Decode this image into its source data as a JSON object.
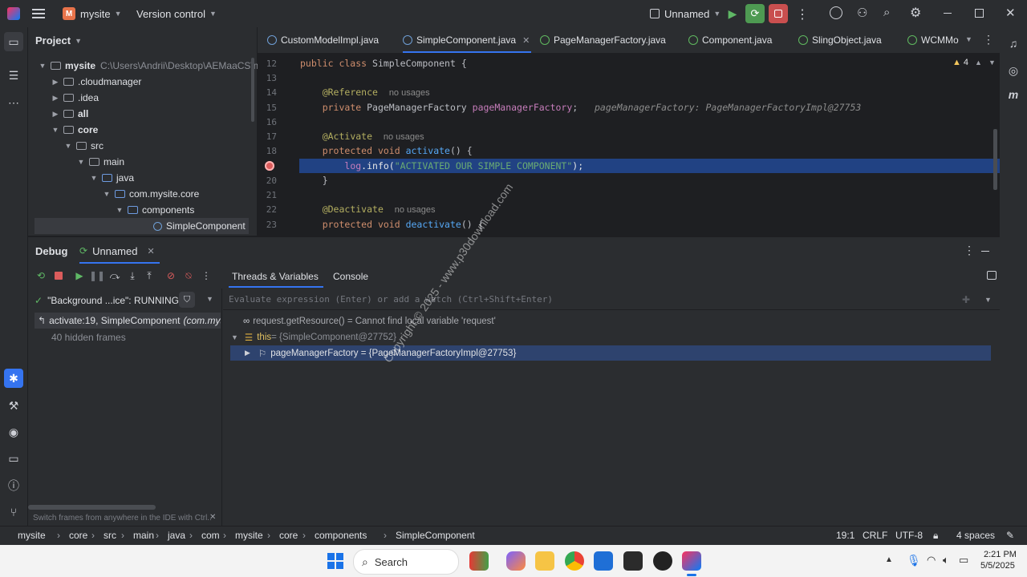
{
  "titlebar": {
    "project_badge": "M",
    "project_name": "mysite",
    "vcs_menu": "Version control",
    "run_config": "Unnamed",
    "icons": [
      "hamburger-icon",
      "play-icon",
      "debug-icon",
      "stop-icon",
      "more-icon",
      "ai-icon",
      "add-user-icon",
      "search-icon",
      "gear-icon",
      "minimize-icon",
      "restore-icon",
      "close-icon"
    ]
  },
  "project_panel": {
    "title": "Project",
    "root_label": "mysite",
    "root_path": "C:\\Users\\Andrii\\Desktop\\AEMaaCS\\my",
    "items": [
      {
        "label": ".cloudmanager",
        "level": 1,
        "expanded": false
      },
      {
        "label": ".idea",
        "level": 1,
        "expanded": false
      },
      {
        "label": "all",
        "level": 1,
        "expanded": false
      },
      {
        "label": "core",
        "level": 1,
        "expanded": true
      },
      {
        "label": "src",
        "level": 2,
        "expanded": true
      },
      {
        "label": "main",
        "level": 3,
        "expanded": true
      },
      {
        "label": "java",
        "level": 4,
        "expanded": true
      },
      {
        "label": "com.mysite.core",
        "level": 5,
        "expanded": true
      },
      {
        "label": "components",
        "level": 6,
        "expanded": true
      },
      {
        "label": "SimpleComponent",
        "level": 7,
        "expanded": false
      }
    ]
  },
  "editor_tabs": [
    {
      "label": "CustomModelImpl.java",
      "active": false
    },
    {
      "label": "SimpleComponent.java",
      "active": true
    },
    {
      "label": "PageManagerFactory.java",
      "active": false
    },
    {
      "label": "Component.java",
      "active": false
    },
    {
      "label": "SlingObject.java",
      "active": false
    },
    {
      "label": "WCMMo",
      "active": false
    }
  ],
  "editor": {
    "warning_count": "4",
    "lines": {
      "n12": "12",
      "n13": "13",
      "n14": "14",
      "n15": "15",
      "n16": "16",
      "n17": "17",
      "n18": "18",
      "n20": "20",
      "n21": "21",
      "n22": "22",
      "n23": "23",
      "l12_kw": "public class",
      "l12_name": "SimpleComponent",
      "l12_brace": " {",
      "l14_ann": "@Reference",
      "l14_hint": "no usages",
      "l15_kw": "private",
      "l15_type": " PageManagerFactory ",
      "l15_field": "pageManagerFactory",
      "l15_semi": ";",
      "l15_inlay": "pageManagerFactory: PageManagerFactoryImpl@27753",
      "l17_ann": "@Activate",
      "l17_hint": "no usages",
      "l18_kw": "protected void",
      "l18_fn": "activate",
      "l18_rest": "() {",
      "l19_field": "log",
      "l19_mid": ".info(",
      "l19_str": "\"ACTIVATED OUR SIMPLE COMPONENT\"",
      "l19_end": ");",
      "l20": "}",
      "l22_ann": "@Deactivate",
      "l22_hint": "no usages",
      "l23_kw": "protected void",
      "l23_fn": "deactivate",
      "l23_rest": "() {"
    }
  },
  "debug": {
    "title": "Debug",
    "session_tab": "Unnamed",
    "tabs": [
      "Threads & Variables",
      "Console"
    ],
    "thread_selector": "\"Background ...ice\": RUNNING",
    "frame_active_method": "activate:19, SimpleComponent",
    "frame_active_pkg": "(com.mysi",
    "hidden_frames": "40 hidden frames",
    "frames_hint": "Switch frames from anywhere in the IDE with Ctrl..",
    "evaluate_placeholder": "Evaluate expression (Enter) or add a watch (Ctrl+Shift+Enter)",
    "variables": {
      "request_line": "request.getResource() = Cannot find local variable 'request'",
      "this_name": "this",
      "this_value": " = {SimpleComponent@27752}",
      "field_line": "pageManagerFactory = {PageManagerFactoryImpl@27753}"
    }
  },
  "statusbar": {
    "breadcrumbs": [
      "mysite",
      "core",
      "src",
      "main",
      "java",
      "com",
      "mysite",
      "core",
      "components",
      "SimpleComponent"
    ],
    "position": "19:1",
    "line_sep": "CRLF",
    "encoding": "UTF-8",
    "indent": "4 spaces"
  },
  "taskbar": {
    "search": "Search",
    "time": "2:21 PM",
    "date": "5/5/2025"
  },
  "watermark": "Copyright © 2025 - www.p30download.com",
  "colors": {
    "accent": "#3574f0",
    "selection": "#214283",
    "breakpoint": "#db5c5c",
    "debug_green": "#5fb865"
  }
}
